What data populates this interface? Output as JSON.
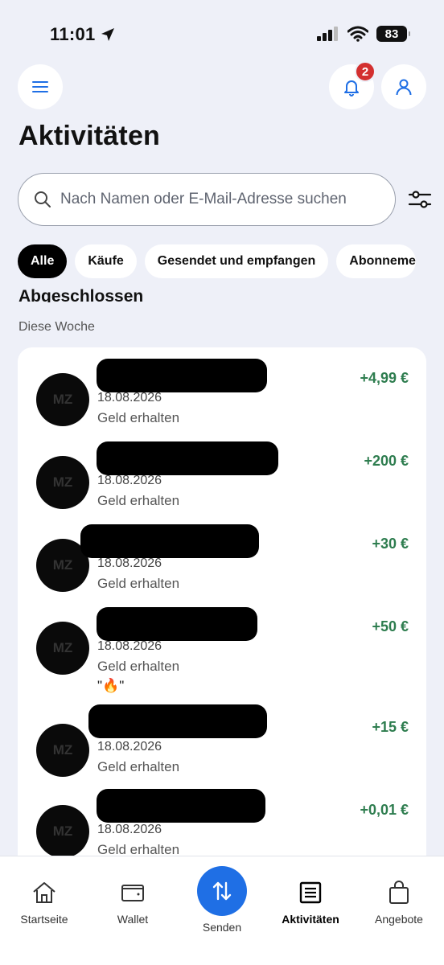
{
  "status": {
    "time": "11:01",
    "battery": "83"
  },
  "header": {
    "notification_count": "2",
    "title": "Aktivitäten"
  },
  "search": {
    "placeholder": "Nach Namen oder E-Mail-Adresse suchen"
  },
  "filters": [
    {
      "label": "Alle",
      "active": true
    },
    {
      "label": "Käufe"
    },
    {
      "label": "Gesendet und empfangen"
    },
    {
      "label": "Abonneme"
    }
  ],
  "section": {
    "title": "Abgeschlossen",
    "subtitle": "Diese Woche"
  },
  "transactions": [
    {
      "initials": "MZ",
      "date": "18.08.2026",
      "type": "Geld erhalten",
      "amount": "+4,99 €",
      "note": ""
    },
    {
      "initials": "MZ",
      "date": "18.08.2026",
      "type": "Geld erhalten",
      "amount": "+200 €",
      "note": ""
    },
    {
      "initials": "MZ",
      "date": "18.08.2026",
      "type": "Geld erhalten",
      "amount": "+30 €",
      "note": ""
    },
    {
      "initials": "MZ",
      "date": "18.08.2026",
      "type": "Geld erhalten",
      "amount": "+50 €",
      "note": "\"🔥\""
    },
    {
      "initials": "MZ",
      "date": "18.08.2026",
      "type": "Geld erhalten",
      "amount": "+15 €",
      "note": ""
    },
    {
      "initials": "MZ",
      "date": "18.08.2026",
      "type": "Geld erhalten",
      "amount": "+0,01 €",
      "note": ""
    }
  ],
  "nav": {
    "home": "Startseite",
    "wallet": "Wallet",
    "send": "Senden",
    "activity": "Aktivitäten",
    "offers": "Angebote"
  },
  "colors": {
    "accent": "#1f6fe5",
    "positive": "#2e7d4f",
    "badge": "#d32f2f"
  }
}
